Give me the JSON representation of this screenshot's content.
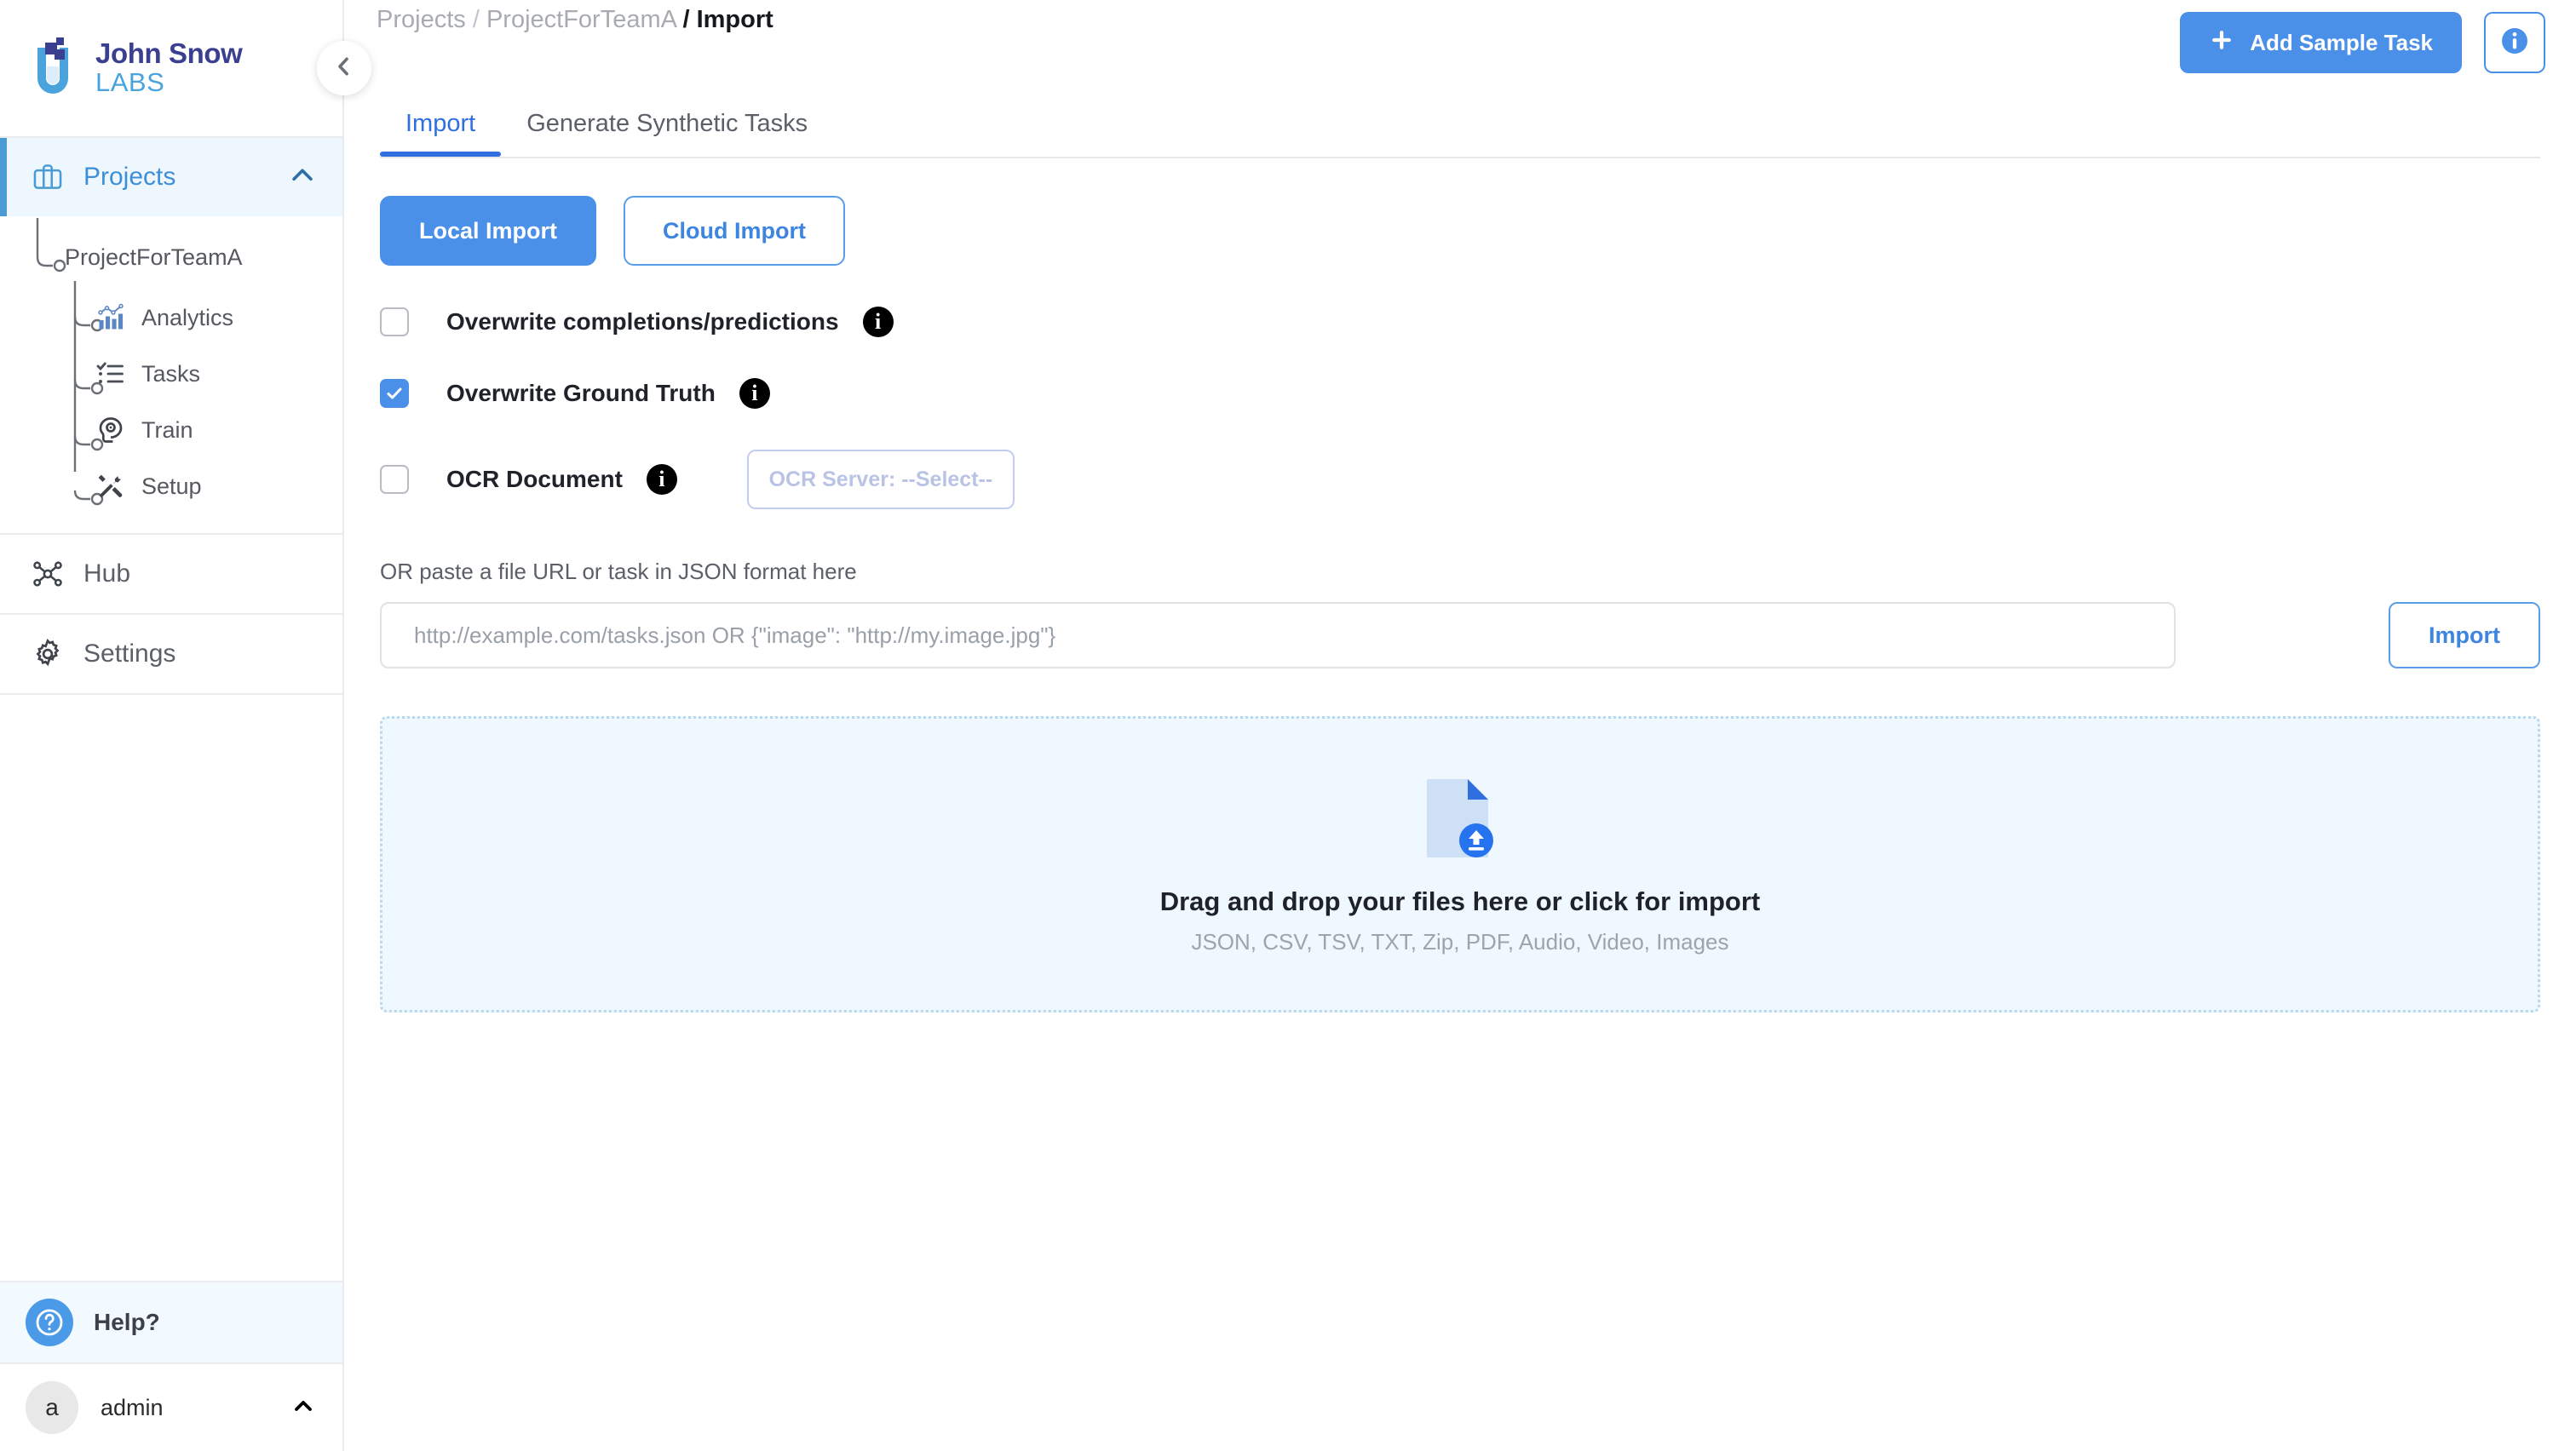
{
  "brand": {
    "line1": "John Snow",
    "line2": "LABS",
    "logo_icon": "john-snow-labs-logo",
    "primary_color": "#3b3f8f",
    "secondary_color": "#4aa3dc"
  },
  "sidebar": {
    "collapse_icon": "chevron-left-icon",
    "nav": [
      {
        "label": "Projects",
        "icon": "briefcase-icon",
        "active": true,
        "caret_icon": "chevron-up-icon"
      },
      {
        "label": "Hub",
        "icon": "hub-network-icon",
        "active": false
      },
      {
        "label": "Settings",
        "icon": "gear-icon",
        "active": false
      }
    ],
    "tree": {
      "project": {
        "label": "ProjectForTeamA"
      },
      "children": [
        {
          "label": "Analytics",
          "icon": "analytics-chart-icon"
        },
        {
          "label": "Tasks",
          "icon": "task-list-icon"
        },
        {
          "label": "Train",
          "icon": "train-head-icon"
        },
        {
          "label": "Setup",
          "icon": "tools-wrench-icon"
        }
      ]
    },
    "help": {
      "label": "Help?",
      "icon": "question-circle-icon"
    },
    "user": {
      "initial": "a",
      "name": "admin",
      "caret_icon": "chevron-up-icon"
    }
  },
  "header": {
    "breadcrumb": {
      "root": "Projects",
      "project": "ProjectForTeamA",
      "current": "Import",
      "separator": "/"
    },
    "add_sample_task_label": "Add Sample Task",
    "add_icon": "plus-icon",
    "info_icon": "info-circle-icon"
  },
  "tabs": [
    {
      "label": "Import",
      "active": true
    },
    {
      "label": "Generate Synthetic Tasks",
      "active": false
    }
  ],
  "import": {
    "source_buttons": [
      {
        "label": "Local Import",
        "style": "filled"
      },
      {
        "label": "Cloud Import",
        "style": "outline"
      }
    ],
    "options": [
      {
        "label": "Overwrite completions/predictions",
        "checked": false,
        "info_icon": "info-filled-icon"
      },
      {
        "label": "Overwrite Ground Truth",
        "checked": true,
        "info_icon": "info-filled-icon"
      },
      {
        "label": "OCR Document",
        "checked": false,
        "info_icon": "info-filled-icon"
      }
    ],
    "ocr_server": {
      "value": "OCR Server: --Select--",
      "enabled": false
    },
    "url_section": {
      "label": "OR paste a file URL or task in JSON format here",
      "value": "",
      "placeholder": "http://example.com/tasks.json OR {\"image\": \"http://my.image.jpg\"}",
      "import_button_label": "Import"
    },
    "dropzone": {
      "title": "Drag and drop your files here or click for import",
      "subtitle": "JSON, CSV, TSV, TXT, Zip, PDF, Audio, Video, Images",
      "icon": "file-upload-icon"
    }
  },
  "colors": {
    "accent_blue": "#4a90e8",
    "tab_blue": "#2f6fe0",
    "active_bg": "#eef7fe",
    "dropzone_bg": "#eef8fe",
    "dropzone_border": "#b9d8ee"
  }
}
